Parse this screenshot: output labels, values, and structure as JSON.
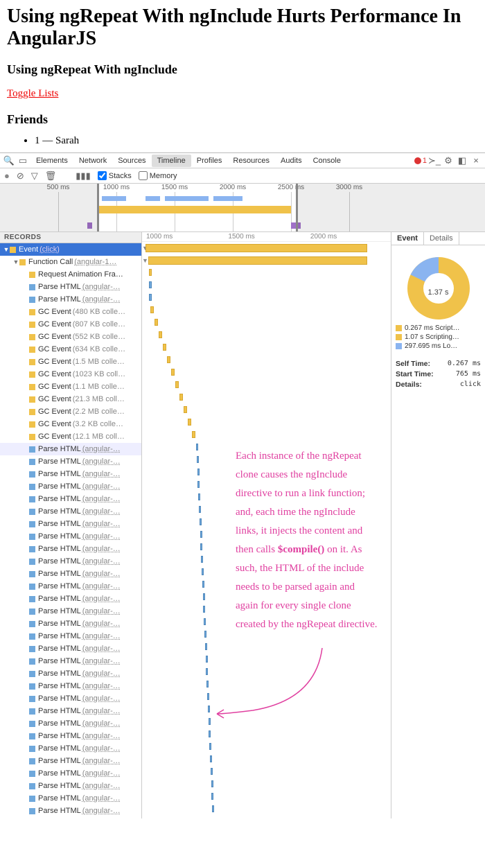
{
  "page": {
    "h1": "Using ngRepeat With ngInclude Hurts Performance In AngularJS",
    "h2": "Using ngRepeat With ngInclude",
    "toggle": "Toggle Lists",
    "h3": "Friends",
    "friend": "1 — Sarah"
  },
  "tabs": [
    "Elements",
    "Network",
    "Sources",
    "Timeline",
    "Profiles",
    "Resources",
    "Audits",
    "Console"
  ],
  "active_tab": "Timeline",
  "errors": "1",
  "toolbar": {
    "stacks": "Stacks",
    "memory": "Memory"
  },
  "overview_ticks": [
    {
      "label": "500 ms",
      "pct": 12
    },
    {
      "label": "1000 ms",
      "pct": 24
    },
    {
      "label": "1500 ms",
      "pct": 36
    },
    {
      "label": "2000 ms",
      "pct": 48
    },
    {
      "label": "2500 ms",
      "pct": 60
    },
    {
      "label": "3000 ms",
      "pct": 72
    }
  ],
  "records_header": "RECORDS",
  "records": [
    {
      "depth": 0,
      "disc": "▼",
      "color": "y",
      "label": "Event",
      "src": "(click)",
      "sel": true
    },
    {
      "depth": 1,
      "disc": "▼",
      "color": "y",
      "label": "Function Call",
      "src": "(angular-1…"
    },
    {
      "depth": 2,
      "disc": "",
      "color": "y",
      "label": "Request Animation Fra…"
    },
    {
      "depth": 2,
      "disc": "",
      "color": "b",
      "label": "Parse HTML",
      "src": "(angular-…"
    },
    {
      "depth": 2,
      "disc": "",
      "color": "b",
      "label": "Parse HTML",
      "src": "(angular-…"
    },
    {
      "depth": 2,
      "disc": "",
      "color": "y",
      "label": "GC Event",
      "meta": "(480 KB colle…"
    },
    {
      "depth": 2,
      "disc": "",
      "color": "y",
      "label": "GC Event",
      "meta": "(807 KB colle…"
    },
    {
      "depth": 2,
      "disc": "",
      "color": "y",
      "label": "GC Event",
      "meta": "(552 KB colle…"
    },
    {
      "depth": 2,
      "disc": "",
      "color": "y",
      "label": "GC Event",
      "meta": "(634 KB colle…"
    },
    {
      "depth": 2,
      "disc": "",
      "color": "y",
      "label": "GC Event",
      "meta": "(1.5 MB colle…"
    },
    {
      "depth": 2,
      "disc": "",
      "color": "y",
      "label": "GC Event",
      "meta": "(1023 KB coll…"
    },
    {
      "depth": 2,
      "disc": "",
      "color": "y",
      "label": "GC Event",
      "meta": "(1.1 MB colle…"
    },
    {
      "depth": 2,
      "disc": "",
      "color": "y",
      "label": "GC Event",
      "meta": "(21.3 MB coll…"
    },
    {
      "depth": 2,
      "disc": "",
      "color": "y",
      "label": "GC Event",
      "meta": "(2.2 MB colle…"
    },
    {
      "depth": 2,
      "disc": "",
      "color": "y",
      "label": "GC Event",
      "meta": "(3.2 KB colle…"
    },
    {
      "depth": 2,
      "disc": "",
      "color": "y",
      "label": "GC Event",
      "meta": "(12.1 MB coll…"
    },
    {
      "depth": 2,
      "disc": "",
      "color": "b",
      "label": "Parse HTML",
      "src": "(angular-…",
      "hover": true
    },
    {
      "depth": 2,
      "disc": "",
      "color": "b",
      "label": "Parse HTML",
      "src": "(angular-…"
    },
    {
      "depth": 2,
      "disc": "",
      "color": "b",
      "label": "Parse HTML",
      "src": "(angular-…"
    },
    {
      "depth": 2,
      "disc": "",
      "color": "b",
      "label": "Parse HTML",
      "src": "(angular-…"
    },
    {
      "depth": 2,
      "disc": "",
      "color": "b",
      "label": "Parse HTML",
      "src": "(angular-…"
    },
    {
      "depth": 2,
      "disc": "",
      "color": "b",
      "label": "Parse HTML",
      "src": "(angular-…"
    },
    {
      "depth": 2,
      "disc": "",
      "color": "b",
      "label": "Parse HTML",
      "src": "(angular-…"
    },
    {
      "depth": 2,
      "disc": "",
      "color": "b",
      "label": "Parse HTML",
      "src": "(angular-…"
    },
    {
      "depth": 2,
      "disc": "",
      "color": "b",
      "label": "Parse HTML",
      "src": "(angular-…"
    },
    {
      "depth": 2,
      "disc": "",
      "color": "b",
      "label": "Parse HTML",
      "src": "(angular-…"
    },
    {
      "depth": 2,
      "disc": "",
      "color": "b",
      "label": "Parse HTML",
      "src": "(angular-…"
    },
    {
      "depth": 2,
      "disc": "",
      "color": "b",
      "label": "Parse HTML",
      "src": "(angular-…"
    },
    {
      "depth": 2,
      "disc": "",
      "color": "b",
      "label": "Parse HTML",
      "src": "(angular-…"
    },
    {
      "depth": 2,
      "disc": "",
      "color": "b",
      "label": "Parse HTML",
      "src": "(angular-…"
    },
    {
      "depth": 2,
      "disc": "",
      "color": "b",
      "label": "Parse HTML",
      "src": "(angular-…"
    },
    {
      "depth": 2,
      "disc": "",
      "color": "b",
      "label": "Parse HTML",
      "src": "(angular-…"
    },
    {
      "depth": 2,
      "disc": "",
      "color": "b",
      "label": "Parse HTML",
      "src": "(angular-…"
    },
    {
      "depth": 2,
      "disc": "",
      "color": "b",
      "label": "Parse HTML",
      "src": "(angular-…"
    },
    {
      "depth": 2,
      "disc": "",
      "color": "b",
      "label": "Parse HTML",
      "src": "(angular-…"
    },
    {
      "depth": 2,
      "disc": "",
      "color": "b",
      "label": "Parse HTML",
      "src": "(angular-…"
    },
    {
      "depth": 2,
      "disc": "",
      "color": "b",
      "label": "Parse HTML",
      "src": "(angular-…"
    },
    {
      "depth": 2,
      "disc": "",
      "color": "b",
      "label": "Parse HTML",
      "src": "(angular-…"
    },
    {
      "depth": 2,
      "disc": "",
      "color": "b",
      "label": "Parse HTML",
      "src": "(angular-…"
    },
    {
      "depth": 2,
      "disc": "",
      "color": "b",
      "label": "Parse HTML",
      "src": "(angular-…"
    },
    {
      "depth": 2,
      "disc": "",
      "color": "b",
      "label": "Parse HTML",
      "src": "(angular-…"
    },
    {
      "depth": 2,
      "disc": "",
      "color": "b",
      "label": "Parse HTML",
      "src": "(angular-…"
    },
    {
      "depth": 2,
      "disc": "",
      "color": "b",
      "label": "Parse HTML",
      "src": "(angular-…"
    },
    {
      "depth": 2,
      "disc": "",
      "color": "b",
      "label": "Parse HTML",
      "src": "(angular-…"
    },
    {
      "depth": 2,
      "disc": "",
      "color": "b",
      "label": "Parse HTML",
      "src": "(angular-…"
    },
    {
      "depth": 2,
      "disc": "",
      "color": "b",
      "label": "Parse HTML",
      "src": "(angular-…"
    }
  ],
  "flame_ruler": [
    {
      "label": "1000 ms",
      "pct": 7
    },
    {
      "label": "1500 ms",
      "pct": 40
    },
    {
      "label": "2000 ms",
      "pct": 73
    }
  ],
  "side": {
    "tabs": [
      "Event",
      "Details"
    ],
    "pie_total": "1.37 s",
    "legend": [
      {
        "color": "#f0c24a",
        "text": "0.267 ms Script…"
      },
      {
        "color": "#f0c24a",
        "text": "1.07 s Scripting…"
      },
      {
        "color": "#8ab4f0",
        "text": "297.695 ms Lo…"
      }
    ],
    "kv": [
      {
        "k": "Self Time:",
        "v": "0.267 ms"
      },
      {
        "k": "Start Time:",
        "v": "765 ms"
      },
      {
        "k": "Details:",
        "v": "click"
      }
    ]
  },
  "annotation": "Each instance of the ngRepeat clone causes the ngInclude directive to run a link function; and, each time the ngInclude links, it injects the content and then calls $compile() on it. As such, the HTML of the include needs to be parsed again and again for every single clone created by the ngRepeat directive.",
  "chart_data": {
    "type": "pie",
    "title": "Event (click) breakdown",
    "total_label": "1.37 s",
    "series": [
      {
        "name": "Scripting (self)",
        "value": 0.000267,
        "unit": "s",
        "color": "#f0c24a"
      },
      {
        "name": "Scripting (children)",
        "value": 1.07,
        "unit": "s",
        "color": "#f0c24a"
      },
      {
        "name": "Loading",
        "value": 0.297695,
        "unit": "s",
        "color": "#8ab4f0"
      }
    ]
  }
}
